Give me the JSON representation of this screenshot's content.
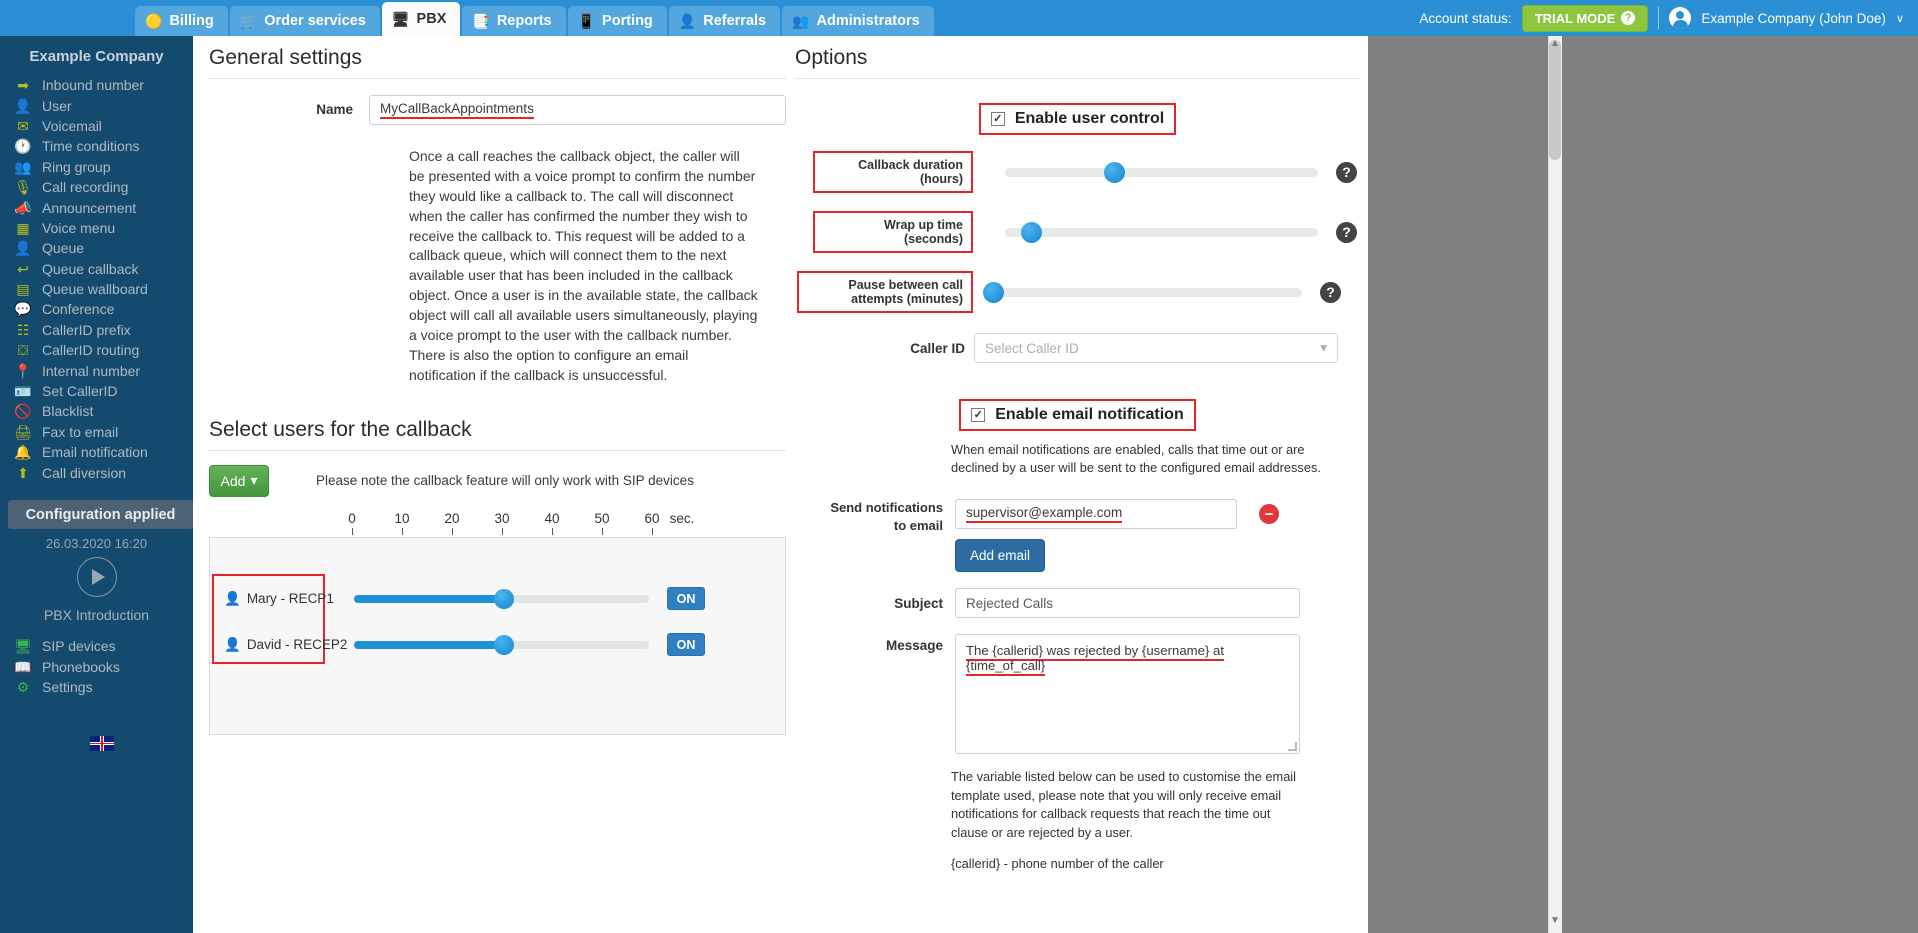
{
  "topnav": {
    "tabs": [
      {
        "label": "Billing",
        "icon": "coins-icon",
        "active": false
      },
      {
        "label": "Order services",
        "icon": "cart-icon",
        "active": false
      },
      {
        "label": "PBX",
        "icon": "pbx-icon",
        "active": true
      },
      {
        "label": "Reports",
        "icon": "report-icon",
        "active": false
      },
      {
        "label": "Porting",
        "icon": "phone-icon",
        "active": false
      },
      {
        "label": "Referrals",
        "icon": "person-icon",
        "active": false
      },
      {
        "label": "Administrators",
        "icon": "admin-icon",
        "active": false
      }
    ],
    "account_status_label": "Account status:",
    "trial_badge": "TRIAL MODE",
    "trial_help": "?",
    "user_name": "Example Company (John Doe)",
    "caret": "∨"
  },
  "sidebar": {
    "title": "Example Company",
    "items": [
      {
        "label": "Inbound number",
        "icon": "arrow-right-icon"
      },
      {
        "label": "User",
        "icon": "user-icon"
      },
      {
        "label": "Voicemail",
        "icon": "envelope-icon"
      },
      {
        "label": "Time conditions",
        "icon": "clock-icon"
      },
      {
        "label": "Ring group",
        "icon": "users-icon"
      },
      {
        "label": "Call recording",
        "icon": "microphone-icon"
      },
      {
        "label": "Announcement",
        "icon": "megaphone-icon"
      },
      {
        "label": "Voice menu",
        "icon": "grid-icon"
      },
      {
        "label": "Queue",
        "icon": "user-plus-icon"
      },
      {
        "label": "Queue callback",
        "icon": "reply-arrow-icon"
      },
      {
        "label": "Queue wallboard",
        "icon": "table-icon"
      },
      {
        "label": "Conference",
        "icon": "chat-bubbles-icon"
      },
      {
        "label": "CallerID prefix",
        "icon": "list-icon"
      },
      {
        "label": "CallerID routing",
        "icon": "sitemap-icon"
      },
      {
        "label": "Internal number",
        "icon": "map-pin-icon"
      },
      {
        "label": "Set CallerID",
        "icon": "id-card-icon"
      },
      {
        "label": "Blacklist",
        "icon": "ban-icon"
      },
      {
        "label": "Fax to email",
        "icon": "printer-icon"
      },
      {
        "label": "Email notification",
        "icon": "bell-icon"
      },
      {
        "label": "Call diversion",
        "icon": "upload-arrow-icon"
      }
    ],
    "status_button": "Configuration applied",
    "status_date": "26.03.2020 16:20",
    "intro_label": "PBX Introduction",
    "bottom_items": [
      {
        "label": "SIP devices",
        "icon": "monitor-icon"
      },
      {
        "label": "Phonebooks",
        "icon": "book-icon"
      },
      {
        "label": "Settings",
        "icon": "gear-icon"
      }
    ],
    "flag": "uk-flag-icon"
  },
  "general": {
    "title": "General settings",
    "name_label": "Name",
    "name_value": "MyCallBackAppointments",
    "description": "Once a call reaches the callback object, the caller will be presented with a voice prompt to confirm the number they would like a callback to. The call will disconnect when the caller has confirmed the number they wish to receive the callback to. This request will be added to a callback queue, which will connect them to the next available user that has been included in the callback object. Once a user is in the available state, the callback object will call all available users simultaneously, playing a voice prompt to the user with the callback number. There is also the option to configure an email notification if the callback is unsuccessful."
  },
  "select_users": {
    "title": "Select users for the callback",
    "add_button": "Add",
    "add_caret": "▾",
    "hint": "Please note the callback feature will only work with SIP devices",
    "ruler_ticks": [
      "0",
      "10",
      "20",
      "30",
      "40",
      "50",
      "60"
    ],
    "ruler_unit": "sec.",
    "rows": [
      {
        "name": "Mary - RECP1",
        "seconds": 30,
        "toggle": "ON"
      },
      {
        "name": "David - RECEP2",
        "seconds": 30,
        "toggle": "ON"
      }
    ]
  },
  "options": {
    "title": "Options",
    "enable_user_control_label": "Enable user control",
    "enable_user_control_checked": "✓",
    "sliders": [
      {
        "label": "Callback duration (hours)",
        "percent": 35
      },
      {
        "label": "Wrap up time (seconds)",
        "percent": 8
      },
      {
        "label": "Pause between call attempts (minutes)",
        "percent": 0
      }
    ],
    "help_icon": "?",
    "caller_id_label": "Caller ID",
    "caller_id_placeholder": "Select Caller ID",
    "caller_id_caret": "▾",
    "enable_email_label": "Enable email notification",
    "enable_email_checked": "✓",
    "email_note": "When email notifications are enabled, calls that time out or are declined by a user will be sent to the configured email addresses.",
    "send_to_label_line1": "Send notifications",
    "send_to_label_line2": "to email",
    "email_value": "supervisor@example.com",
    "remove_icon": "−",
    "add_email_button": "Add email",
    "subject_label": "Subject",
    "subject_value": "Rejected Calls",
    "message_label": "Message",
    "message_value": "The {callerid} was rejected by {username} at {time_of_call}",
    "footnote": "The variable listed below can be used to customise the email template used, please note that you will only receive email notifications for callback requests that reach the time out clause or are rejected by a user.",
    "footnote2": "{callerid} - phone number of the caller"
  },
  "colors": {
    "topbar": "#2a8fd4",
    "sidebar": "#134a6e",
    "accent_blue": "#1f8fd8",
    "green": "#52a447",
    "annotation_red": "#e8242a",
    "trial_green": "#8cc63e"
  }
}
